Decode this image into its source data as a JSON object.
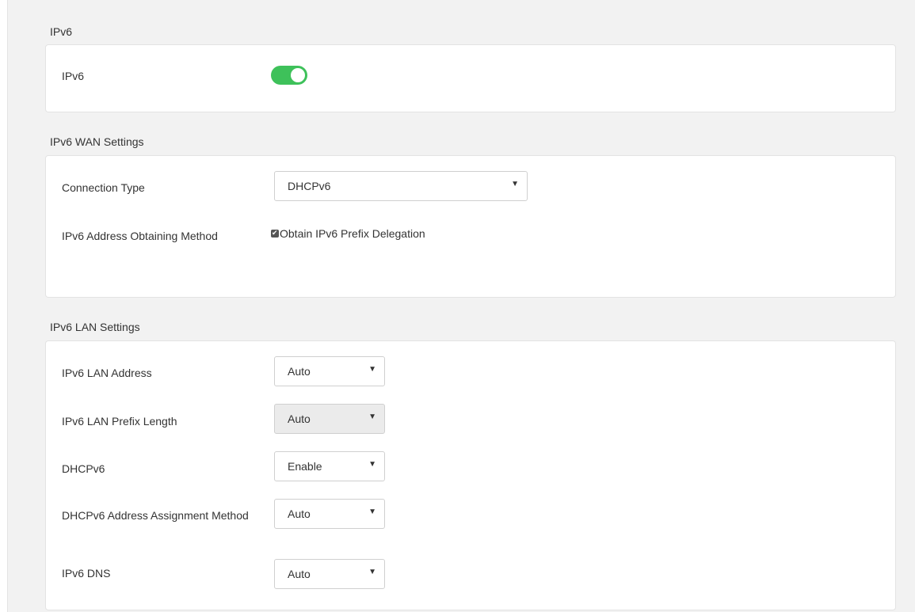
{
  "ipv6": {
    "section_title": "IPv6",
    "toggle_label": "IPv6",
    "enabled": true,
    "toggle_color": "#3ec15a"
  },
  "wan": {
    "section_title": "IPv6 WAN Settings",
    "connection_type_label": "Connection Type",
    "connection_type_value": "DHCPv6",
    "address_method_label": "IPv6 Address Obtaining Method",
    "prefix_delegation_label": "Obtain IPv6 Prefix Delegation",
    "prefix_delegation_checked": true
  },
  "lan": {
    "section_title": "IPv6 LAN Settings",
    "rows": [
      {
        "label": "IPv6 LAN Address",
        "value": "Auto",
        "disabled": false
      },
      {
        "label": "IPv6 LAN Prefix Length",
        "value": "Auto",
        "disabled": true
      },
      {
        "label": "DHCPv6",
        "value": "Enable",
        "disabled": false
      },
      {
        "label": "DHCPv6 Address Assignment Method",
        "value": "Auto",
        "disabled": false
      },
      {
        "label": "IPv6 DNS",
        "value": "Auto",
        "disabled": false
      }
    ]
  },
  "icons": {
    "dropdown": "chevron-down-icon",
    "checkbox": "checkmark-icon"
  }
}
